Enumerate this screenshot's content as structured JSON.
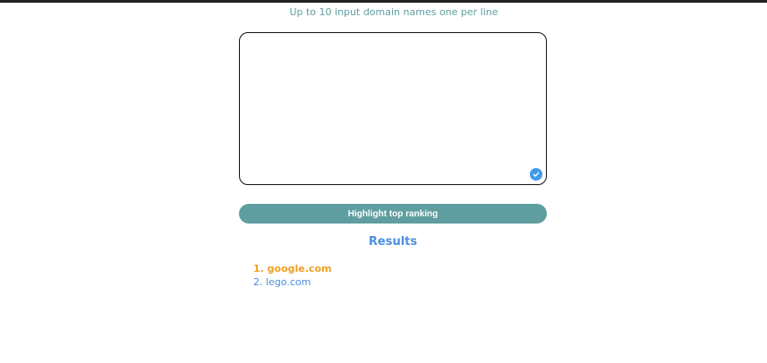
{
  "instruction": "Up to 10 input domain names one per line",
  "input": {
    "value": ""
  },
  "button": {
    "label": "Highlight top ranking"
  },
  "results": {
    "heading": "Results",
    "items": [
      {
        "text": "1. google.com",
        "highlighted": true
      },
      {
        "text": "2. lego.com",
        "highlighted": false
      }
    ]
  },
  "icons": {
    "textarea_status": "check-circle-icon"
  },
  "colors": {
    "accent": "#5f9ea0",
    "link": "#4b8fe0",
    "highlight": "#f0a020",
    "check_badge": "#3d9be9"
  }
}
